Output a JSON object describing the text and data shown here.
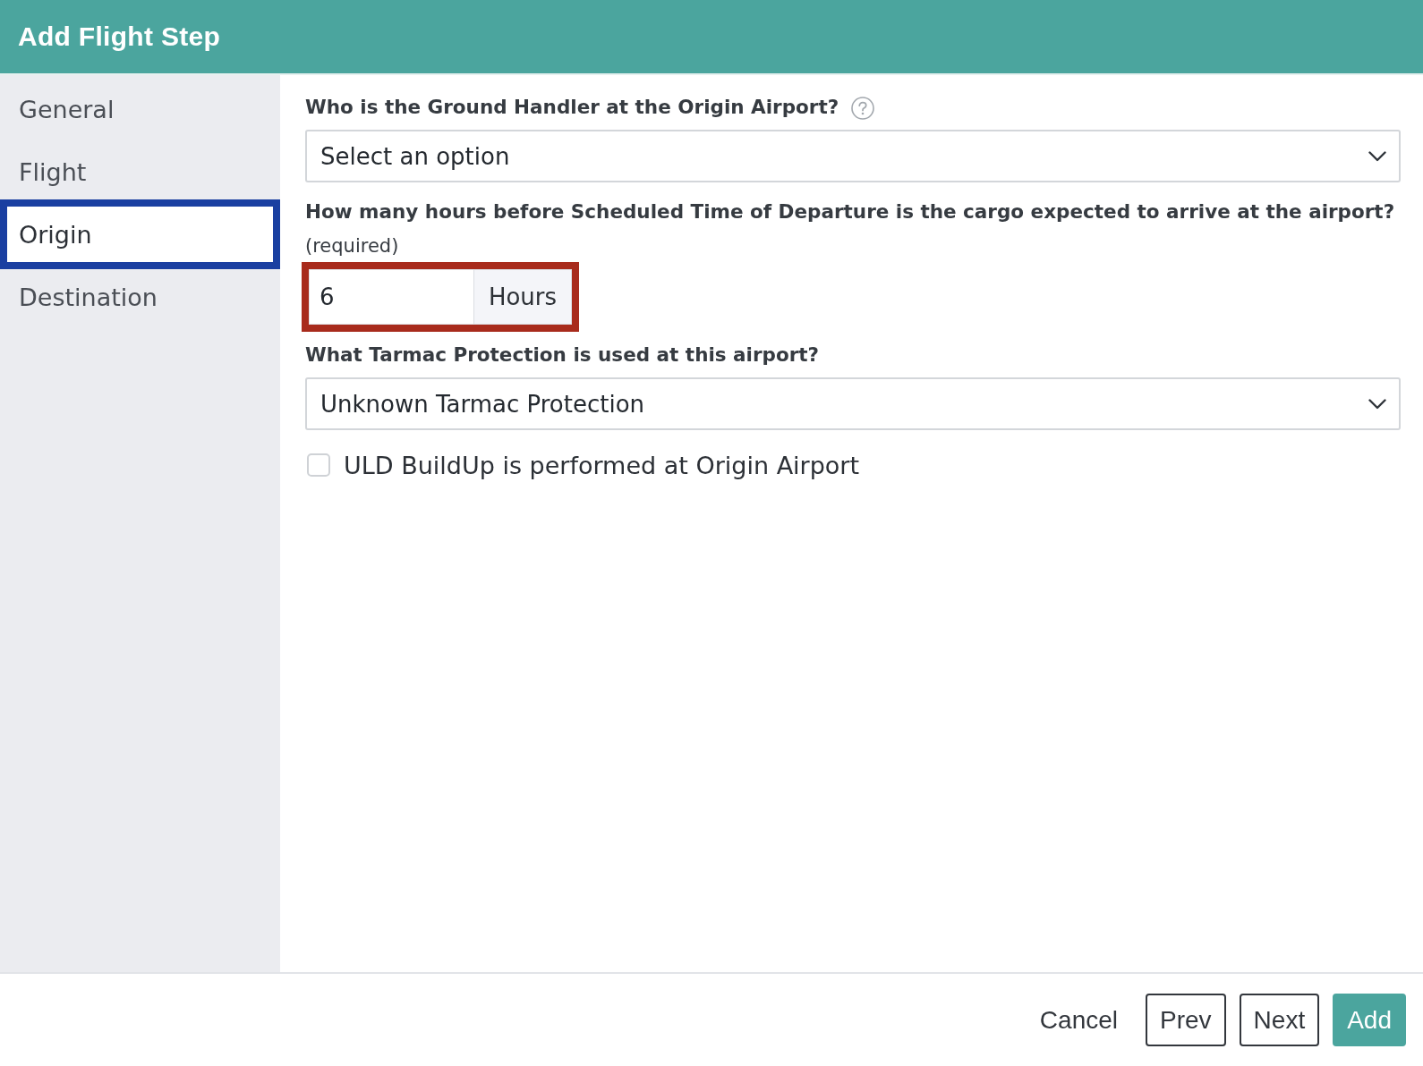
{
  "dialog": {
    "title": "Add Flight Step"
  },
  "sidebar": {
    "items": [
      {
        "label": "General",
        "selected": false
      },
      {
        "label": "Flight",
        "selected": false
      },
      {
        "label": "Origin",
        "selected": true
      },
      {
        "label": "Destination",
        "selected": false
      }
    ]
  },
  "form": {
    "fields": [
      {
        "kind": "select",
        "label": "Who is the Ground Handler at the Origin Airport?",
        "help": true,
        "placeholder": "Select an option"
      },
      {
        "kind": "number",
        "label": "How many hours before Scheduled Time of Departure is the cargo expected to arrive at the airport?",
        "note": "(required)",
        "value": "6",
        "unit": "Hours",
        "highlighted": true
      },
      {
        "kind": "select",
        "label": "What Tarmac Protection is used at this airport?",
        "value": "Unknown Tarmac Protection"
      },
      {
        "kind": "checkbox",
        "label": "ULD BuildUp is performed at Origin Airport",
        "checked": false
      }
    ]
  },
  "footer": {
    "buttons": [
      {
        "label": "Cancel",
        "kind": "link"
      },
      {
        "label": "Prev",
        "kind": "outline"
      },
      {
        "label": "Next",
        "kind": "outline"
      },
      {
        "label": "Add",
        "kind": "primary"
      }
    ]
  }
}
